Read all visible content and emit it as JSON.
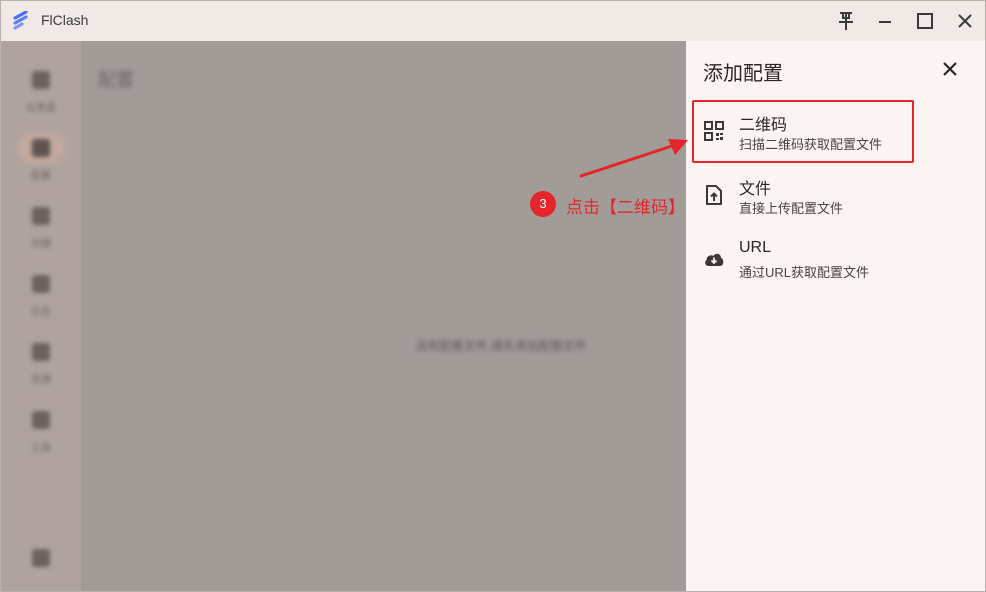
{
  "app": {
    "title": "FlClash"
  },
  "sidebar": {
    "items": [
      {
        "label": "仪表盘",
        "icon": "dashboard-icon"
      },
      {
        "label": "配置",
        "icon": "folder-icon"
      },
      {
        "label": "代理",
        "icon": "proxy-icon"
      },
      {
        "label": "日志",
        "icon": "log-icon"
      },
      {
        "label": "资源",
        "icon": "resource-icon"
      },
      {
        "label": "工具",
        "icon": "tools-icon"
      },
      {
        "label": "",
        "icon": "theme-icon"
      }
    ]
  },
  "main": {
    "heading": "配置",
    "empty_text": "没有配置文件,请先添加配置文件"
  },
  "panel": {
    "title": "添加配置",
    "options": [
      {
        "title": "二维码",
        "desc": "扫描二维码获取配置文件",
        "icon": "qr-code-icon"
      },
      {
        "title": "文件",
        "desc": "直接上传配置文件",
        "icon": "file-upload-icon"
      },
      {
        "title": "URL",
        "desc": "通过URL获取配置文件",
        "icon": "cloud-download-icon"
      }
    ]
  },
  "annotation": {
    "step": "3",
    "text": "点击【二维码】"
  },
  "colors": {
    "accent": "#e5252a",
    "panel_bg": "#fcf4f2",
    "scrim": "#a29c99",
    "logo": "#4a6cf7"
  }
}
